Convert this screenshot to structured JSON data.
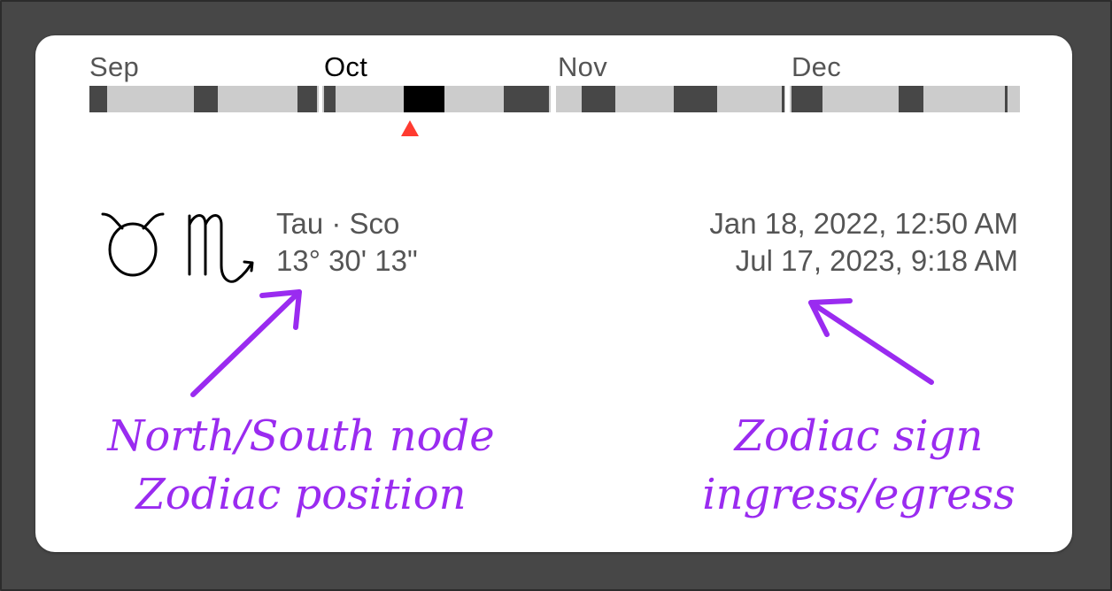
{
  "timeline": {
    "months": [
      {
        "label": "Sep",
        "current": false
      },
      {
        "label": "Oct",
        "current": true
      },
      {
        "label": "Nov",
        "current": false
      },
      {
        "label": "Dec",
        "current": false
      }
    ]
  },
  "node_glyphs": {
    "north": "♉",
    "south": "♏"
  },
  "node_info": {
    "signs": "Tau · Sco",
    "position": "13° 30' 13\""
  },
  "ingress_egress": {
    "ingress": "Jan 18, 2022, 12:50 AM",
    "egress": "Jul 17, 2023, 9:18 AM"
  },
  "annotations": {
    "left_line1": "North/South node",
    "left_line2": "Zodiac position",
    "right_line1": "Zodiac sign",
    "right_line2": "ingress/egress"
  },
  "colors": {
    "annotation": "#9a2bf0",
    "marker": "#ff3b30",
    "background": "#474747"
  }
}
